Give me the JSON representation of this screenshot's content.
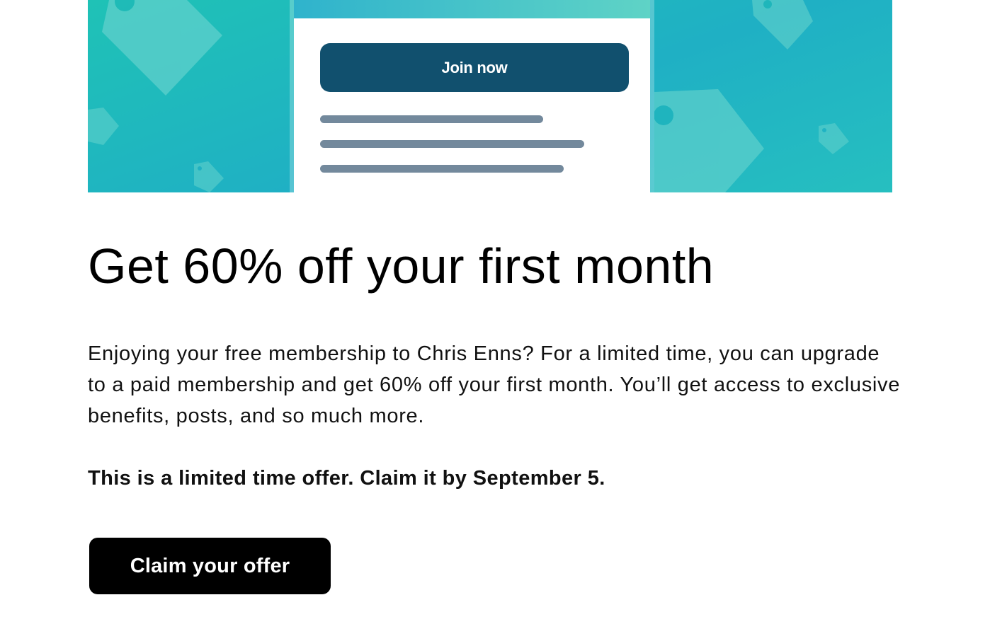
{
  "hero": {
    "join_label": "Join now",
    "colors": {
      "background_start": "#1fc2b6",
      "background_end": "#1fb0c4",
      "tag_shape": "#5fd0cc",
      "join_button": "#11506e",
      "skeleton_line": "#73899c"
    },
    "icons": [
      "price-tag-icon"
    ]
  },
  "content": {
    "headline": "Get 60% off your first month",
    "body": "Enjoying your free membership to Chris Enns? For a limited time, you can upgrade to a paid membership and get 60% off your first month. You’ll get access to exclusive benefits, posts, and so much more.",
    "offer_note": "This is a limited time offer. Claim it by September 5.",
    "cta_label": "Claim your offer"
  },
  "colors": {
    "cta_background": "#000000",
    "cta_text": "#ffffff",
    "text": "#000000"
  }
}
